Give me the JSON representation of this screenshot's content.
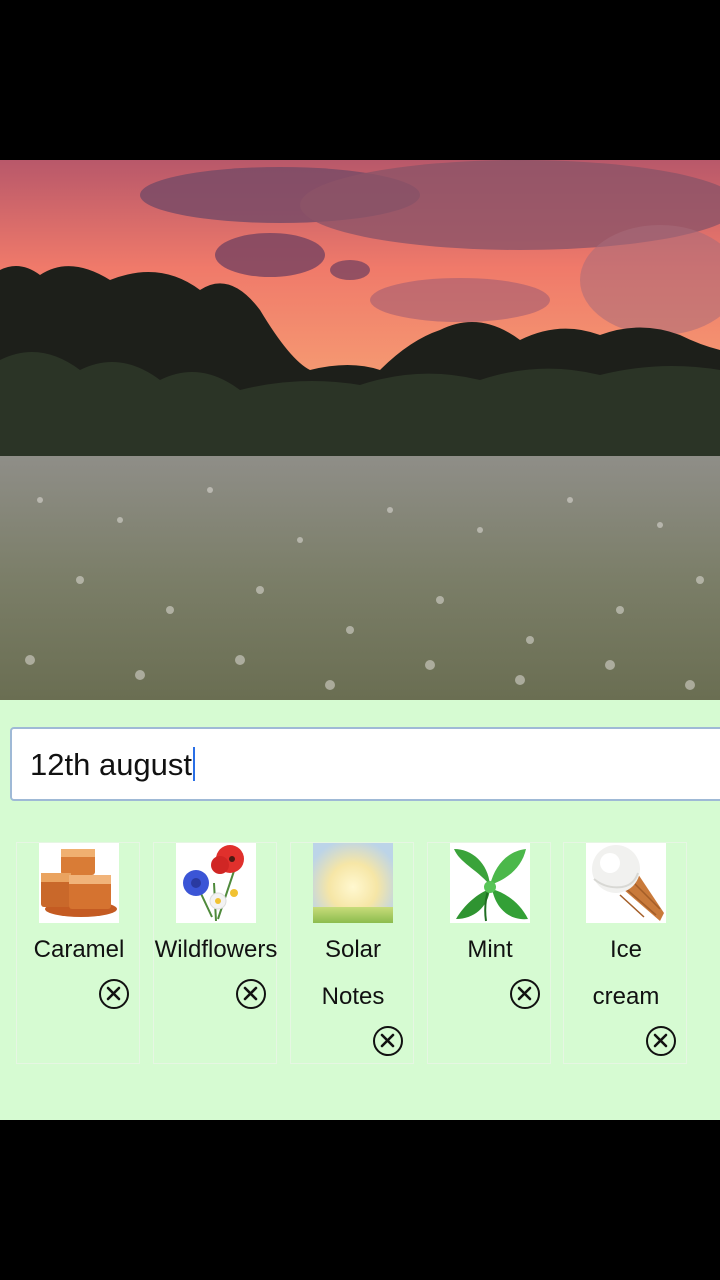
{
  "search": {
    "value": "12th august"
  },
  "cards": [
    {
      "label": "Caramel",
      "image": "caramel-image",
      "remove_icon": "close-circle-icon"
    },
    {
      "label": "Wildflowers",
      "image": "wildflowers-image",
      "remove_icon": "close-circle-icon"
    },
    {
      "label_line1": "Solar",
      "label_line2": "Notes",
      "image": "solar-notes-image",
      "remove_icon": "close-circle-icon"
    },
    {
      "label": "Mint",
      "image": "mint-image",
      "remove_icon": "close-circle-icon"
    },
    {
      "label_line1": "Ice",
      "label_line2": "cream",
      "image": "ice-cream-image",
      "remove_icon": "close-circle-icon"
    }
  ],
  "colors": {
    "panel_bg": "#d6fbd2",
    "input_border": "#9fb9d6",
    "caret": "#2a6fe6"
  }
}
